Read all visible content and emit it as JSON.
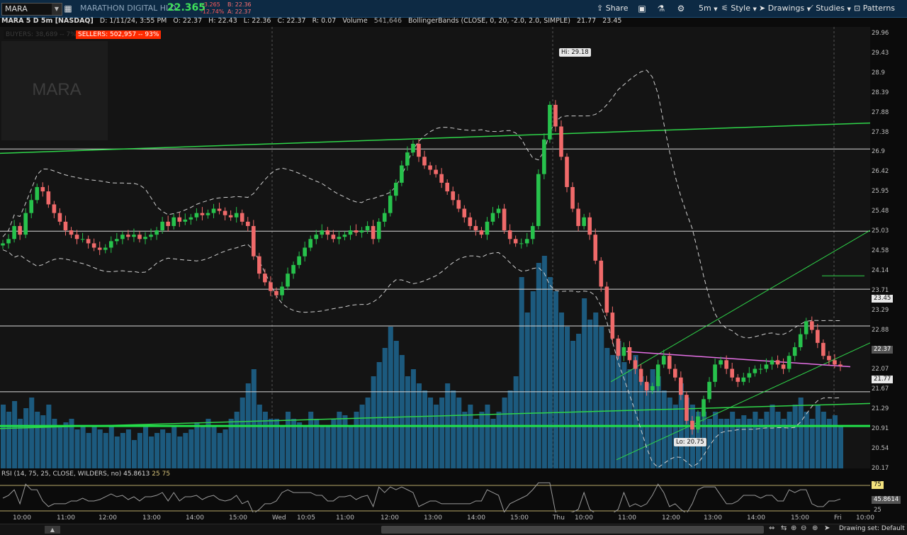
{
  "toolbar": {
    "symbol": "MARA",
    "company": "MARATHON DIGITAL HLD",
    "last": "22.365",
    "change": "-3.265",
    "change_pct": "-12.74%",
    "bid": "B: 22.36",
    "ask": "A: 22.37",
    "share": "Share",
    "timeframe": "5m",
    "style": "Style",
    "drawings": "Drawings",
    "studies": "Studies",
    "patterns": "Patterns"
  },
  "info": {
    "title": "MARA 5 D 5m [NASDAQ]",
    "date": "D: 1/11/24, 3:55 PM",
    "open": "O: 22.37",
    "high": "H: 22.43",
    "low": "L: 22.36",
    "close": "C: 22.37",
    "range": "R: 0.07",
    "volume_label": "Volume",
    "volume": "541,646",
    "bb_label": "BollingerBands (CLOSE, 0, 20, -2.0, 2.0, SIMPLE)",
    "bb_lower": "21.77",
    "bb_upper": "23.45"
  },
  "buyers": "BUYERS: 38,689 -- 7%",
  "sellers": "SELLERS: 502,957 -- 93%",
  "watermark": "MARA",
  "annotations": {
    "hi": "Hi: 29.18",
    "lo": "Lo: 20.75"
  },
  "price_axis": [
    "29.96",
    "29.43",
    "28.9",
    "28.39",
    "27.88",
    "27.38",
    "26.9",
    "26.42",
    "25.95",
    "25.48",
    "25.03",
    "24.58",
    "24.14",
    "23.71",
    "23.29",
    "22.88",
    "22.47",
    "22.07",
    "21.67",
    "21.29",
    "20.91",
    "20.54",
    "20.17"
  ],
  "price_badges": {
    "upper": "23.45",
    "last": "22.37",
    "lower": "21.77"
  },
  "rsi": {
    "label": "RSI (14, 75, 25, CLOSE, WILDERS, no)",
    "value": "45.8613",
    "low": "25",
    "high": "75",
    "badge_high": "75",
    "badge_value": "45.8614",
    "badge_low": "25"
  },
  "time_axis": [
    "10:00",
    "11:00",
    "12:00",
    "13:00",
    "14:00",
    "15:00",
    "Wed",
    "10:05",
    "11:00",
    "12:00",
    "13:00",
    "14:00",
    "15:00",
    "Thu",
    "10:00",
    "11:00",
    "12:00",
    "13:00",
    "14:00",
    "15:00",
    "Fri",
    "10:00"
  ],
  "status": {
    "drawing_set": "Drawing set: Default"
  },
  "colors": {
    "up": "#27c24c",
    "down": "#f06a6a",
    "volume": "#1c5a7e",
    "trend": "#2fd64a",
    "accent": "#0d2a44"
  },
  "chart_data": {
    "type": "candlestick",
    "ylim": [
      20.0,
      30.2
    ],
    "closes": [
      25.2,
      25.3,
      25.6,
      25.4,
      25.9,
      26.2,
      26.5,
      26.4,
      26.1,
      25.9,
      25.7,
      25.5,
      25.4,
      25.3,
      25.3,
      25.2,
      25.1,
      25.05,
      25.1,
      25.25,
      25.3,
      25.4,
      25.35,
      25.4,
      25.3,
      25.35,
      25.4,
      25.5,
      25.7,
      25.6,
      25.8,
      25.7,
      25.75,
      25.8,
      25.9,
      25.85,
      25.9,
      26.0,
      25.95,
      25.85,
      25.8,
      25.9,
      25.7,
      25.6,
      24.9,
      24.5,
      24.3,
      24.1,
      24.0,
      24.2,
      24.5,
      24.7,
      24.9,
      25.1,
      25.3,
      25.4,
      25.5,
      25.4,
      25.3,
      25.35,
      25.4,
      25.5,
      25.45,
      25.5,
      25.6,
      25.3,
      25.7,
      25.9,
      26.3,
      26.6,
      27.0,
      27.3,
      27.5,
      27.2,
      27.0,
      26.9,
      26.8,
      26.6,
      26.4,
      26.2,
      26.0,
      25.8,
      25.6,
      25.5,
      25.4,
      25.7,
      25.9,
      26.0,
      25.5,
      25.3,
      25.2,
      25.2,
      25.3,
      25.6,
      26.8,
      27.6,
      28.4,
      27.9,
      27.2,
      26.5,
      26.0,
      25.6,
      25.8,
      25.4,
      24.8,
      24.2,
      23.6,
      23.0,
      22.6,
      22.8,
      22.5,
      22.3,
      22.0,
      21.8,
      21.9,
      22.4,
      22.6,
      22.3,
      22.1,
      21.7,
      21.1,
      20.9,
      21.2,
      21.6,
      22.0,
      22.4,
      22.5,
      22.3,
      22.1,
      22.0,
      22.1,
      22.2,
      22.3,
      22.3,
      22.4,
      22.5,
      22.4,
      22.3,
      22.6,
      22.8,
      23.1,
      23.4,
      23.2,
      22.9,
      22.6,
      22.5,
      22.4,
      22.37
    ],
    "volumes": [
      0.9,
      0.8,
      0.95,
      0.7,
      0.85,
      1.0,
      0.8,
      0.75,
      0.9,
      0.7,
      0.6,
      0.65,
      0.7,
      0.55,
      0.6,
      0.5,
      0.6,
      0.55,
      0.5,
      0.6,
      0.45,
      0.5,
      0.55,
      0.4,
      0.5,
      0.6,
      0.45,
      0.5,
      0.55,
      0.5,
      0.6,
      0.45,
      0.5,
      0.55,
      0.65,
      0.6,
      0.7,
      0.6,
      0.5,
      0.55,
      0.7,
      0.8,
      1.0,
      1.2,
      1.4,
      0.9,
      0.8,
      0.7,
      0.7,
      0.6,
      0.8,
      0.7,
      0.65,
      0.6,
      0.8,
      0.7,
      0.6,
      0.6,
      0.7,
      0.8,
      0.75,
      0.6,
      0.8,
      0.9,
      1.0,
      1.3,
      1.5,
      1.7,
      2.0,
      1.8,
      1.6,
      1.3,
      1.4,
      1.2,
      1.1,
      1.0,
      0.9,
      1.0,
      1.2,
      1.1,
      1.0,
      0.8,
      0.9,
      0.7,
      0.8,
      0.9,
      0.7,
      0.8,
      1.0,
      1.1,
      1.3,
      2.7,
      2.2,
      2.5,
      2.9,
      3.0,
      2.7,
      2.5,
      2.2,
      2.0,
      1.8,
      1.9,
      2.4,
      2.1,
      2.2,
      2.0,
      1.7,
      1.6,
      1.8,
      1.5,
      1.4,
      1.6,
      1.3,
      1.2,
      1.4,
      1.3,
      1.1,
      1.0,
      0.9,
      1.2,
      1.0,
      0.9,
      0.8,
      0.8,
      0.7,
      0.8,
      0.7,
      0.7,
      0.8,
      0.7,
      0.75,
      0.7,
      0.8,
      0.7,
      0.8,
      0.9,
      0.8,
      0.7,
      0.8,
      0.9,
      1.0,
      0.8,
      0.7,
      0.9,
      0.8,
      0.7,
      0.75,
      0.6
    ]
  }
}
